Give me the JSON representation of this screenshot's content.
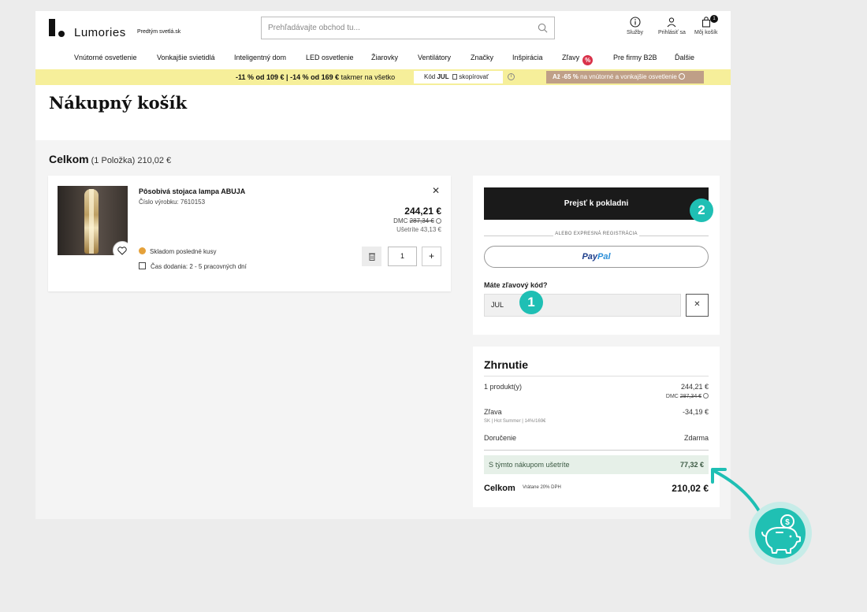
{
  "header": {
    "logo_text": "Lumories",
    "tagline": "Predtým svetlá.sk",
    "search_placeholder": "Prehľadávajte obchod tu...",
    "actions": [
      {
        "label": "Služby",
        "icon": "info-icon"
      },
      {
        "label": "Prihlásiť sa",
        "icon": "user-icon"
      },
      {
        "label": "Môj košík",
        "icon": "cart-icon",
        "badge": "1"
      }
    ]
  },
  "nav": [
    "Vnútorné osvetlenie",
    "Vonkajšie svietidlá",
    "Inteligentný dom",
    "LED osvetlenie",
    "Žiarovky",
    "Ventilátory",
    "Značky",
    "Inšpirácia",
    "Zľavy",
    "Pre firmy B2B",
    "Ďalšie"
  ],
  "nav_sale_badge": "%",
  "promo": {
    "text_a": "-11 % od 109 €",
    "text_sep": " | ",
    "text_b": "-14 % od 169 €",
    "text_c": " takmer na všetko",
    "code_label": "Kód",
    "code": "JUL",
    "copy_label": "skopírovať",
    "right_bold": "Až -65 %",
    "right_text": " na vnútorné a vonkajšie osvetlenie"
  },
  "page_title": "Nákupný košík",
  "cart_total": {
    "label": "Celkom",
    "count": "(1 Položka)",
    "amount": "210,02 €"
  },
  "item": {
    "name": "Pôsobivá stojaca lampa ABUJA",
    "sku": "Číslo výrobku: 7610153",
    "price": "244,21 €",
    "dmc_label": "DMC",
    "dmc_old": "287,34 €",
    "save": "Ušetríte 43,13 €",
    "stock": "Skladom posledné kusy",
    "delivery": "Čas dodania: 2 - 5 pracovných dní",
    "quantity": "1"
  },
  "checkout": {
    "button": "Prejsť k pokladni",
    "divider": "ALEBO EXPRESNÁ REGISTRÁCIA",
    "paypal_a": "Pay",
    "paypal_b": "Pal",
    "coupon_label": "Máte zľavový kód?",
    "coupon_value": "JUL"
  },
  "summary": {
    "title": "Zhrnutie",
    "products_label": "1 produkt(y)",
    "products_value": "244,21 €",
    "products_dmc": "DMC",
    "products_dmc_old": "287,34 €",
    "discount_label": "Zľava",
    "discount_sub": "SK | Hot Summer | 14%/169€",
    "discount_value": "-34,19 €",
    "shipping_label": "Doručenie",
    "shipping_value": "Zdarma",
    "savings_label": "S týmto nákupom ušetríte",
    "savings_value": "77,32 €",
    "total_label": "Celkom",
    "total_vat": "Vrátane 20% DPH",
    "total_value": "210,02 €"
  },
  "annotations": [
    "1",
    "2"
  ],
  "colors": {
    "accent_teal": "#1fbfb4",
    "promo_yellow": "#f6ef9a",
    "promo_tan": "#bf9f87",
    "sale_red": "#d9324a",
    "savings_green_bg": "#e6f0e8"
  }
}
